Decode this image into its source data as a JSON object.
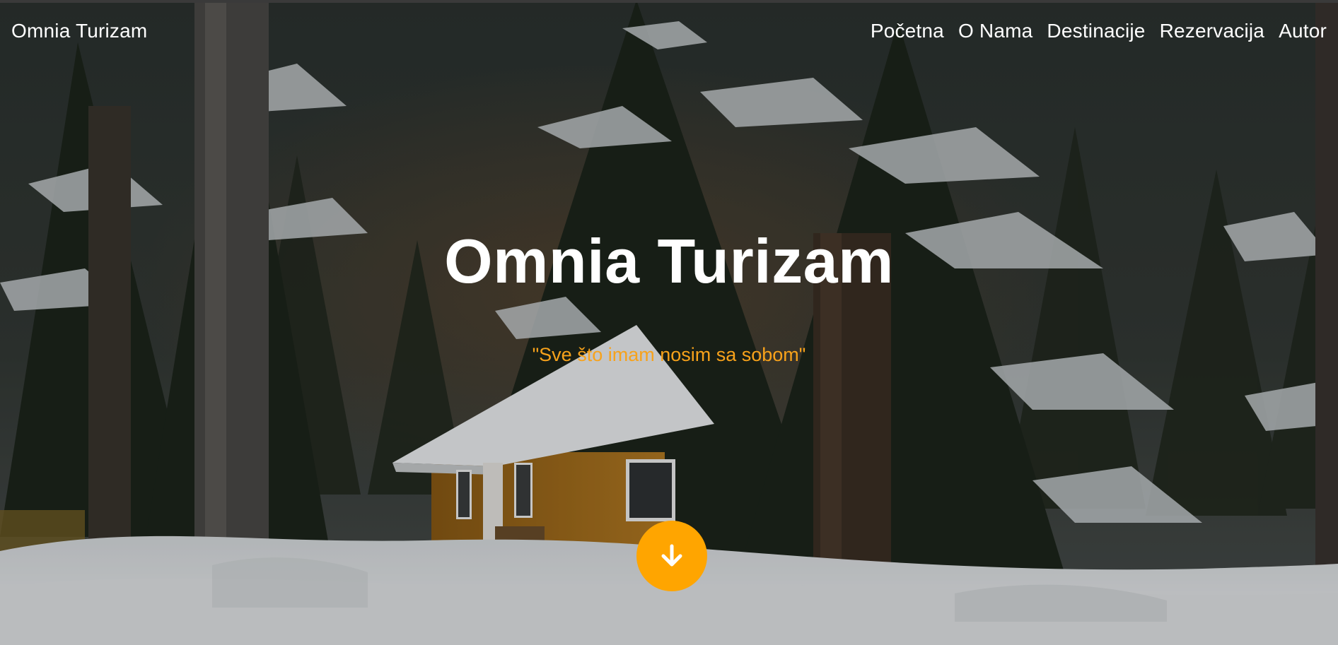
{
  "header": {
    "brand": "Omnia Turizam",
    "nav": [
      {
        "label": "Početna"
      },
      {
        "label": "O Nama"
      },
      {
        "label": "Destinacije"
      },
      {
        "label": "Rezervacija"
      },
      {
        "label": "Autor"
      }
    ]
  },
  "hero": {
    "title": "Omnia Turizam",
    "quote": "\"Sve što imam nosim sa sobom\"",
    "scroll_icon": "arrow-down-icon"
  },
  "colors": {
    "accent": "#ffa500",
    "quote": "#f7a21b",
    "text": "#ffffff"
  }
}
